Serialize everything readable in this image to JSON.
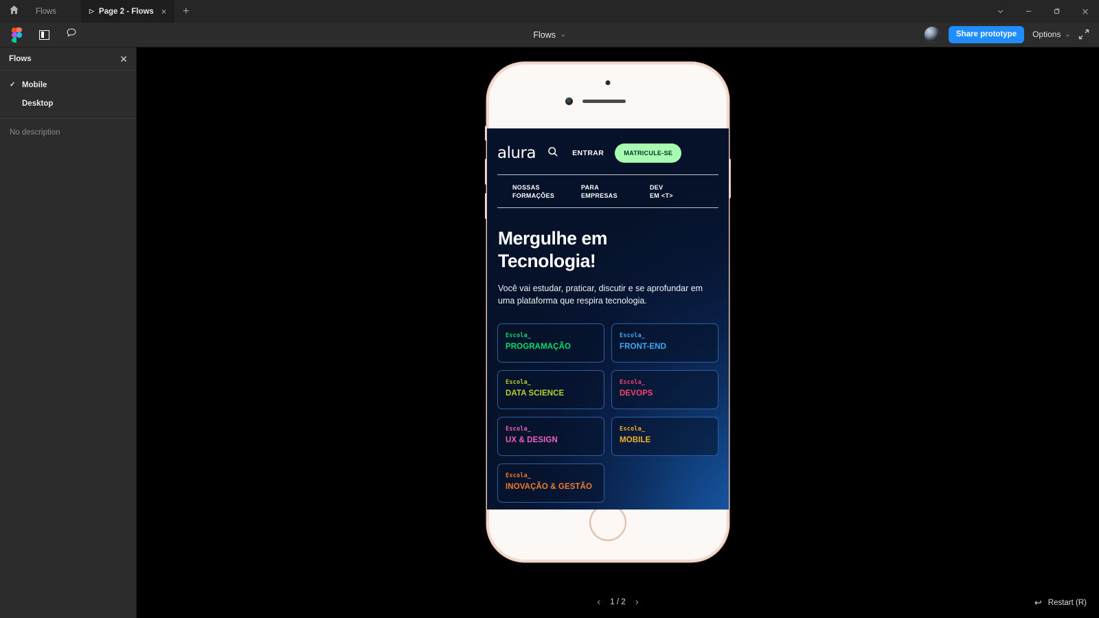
{
  "titlebar": {
    "home_icon": "home-icon",
    "tabs": [
      {
        "label": "Flows",
        "active": false,
        "icon": ""
      },
      {
        "label": "Page 2 - Flows",
        "active": true,
        "icon": "play-icon"
      }
    ],
    "new_tab": "+",
    "window_controls": [
      "chevron-down-icon",
      "minimize-icon",
      "maximize-icon",
      "close-icon"
    ],
    "tab_close": "×"
  },
  "toolbar": {
    "figma_logo": "figma-logo",
    "panel_toggle_icon": "layout-panel-icon",
    "comment_icon": "comment-bubble-icon",
    "title": "Flows",
    "title_chevron": "⌄",
    "avatar": "user-avatar",
    "share_label": "Share prototype",
    "options_label": "Options",
    "options_chevron": "⌄",
    "fullscreen_icon": "fullscreen-icon",
    "accent_blue": "#1f8cff"
  },
  "sidebar": {
    "title": "Flows",
    "close": "✕",
    "items": [
      {
        "label": "Mobile",
        "checked": true,
        "check": "✓"
      },
      {
        "label": "Desktop",
        "checked": false,
        "check": ""
      }
    ],
    "description": "No description"
  },
  "prototype": {
    "device": "iphone-8-white",
    "site": {
      "logo": "alura",
      "search_icon": "search-icon",
      "login_label": "ENTRAR",
      "cta_label": "MATRICULE-SE",
      "cta_color": "#a6ffb0",
      "nav": [
        {
          "line1": "NOSSAS",
          "line2": "FORMAÇÕES"
        },
        {
          "line1": "PARA",
          "line2": "EMPRESAS"
        },
        {
          "line1": "DEV",
          "line2": "EM <T>"
        }
      ],
      "hero_title_line1": "Mergulhe em",
      "hero_title_line2": "Tecnologia!",
      "hero_sub": "Você vai estudar, praticar, discutir e se aprofundar em uma plataforma que respira tecnologia.",
      "card_kicker": "Escola_",
      "cards": [
        {
          "kicker": "Escola_",
          "name": "PROGRAMAÇÃO",
          "color": "#00e06a"
        },
        {
          "kicker": "Escola_",
          "name": "FRONT-END",
          "color": "#3fa9f5"
        },
        {
          "kicker": "Escola_",
          "name": "DATA SCIENCE",
          "color": "#b4d12c"
        },
        {
          "kicker": "Escola_",
          "name": "DEVOPS",
          "color": "#f4436c"
        },
        {
          "kicker": "Escola_",
          "name": "UX & DESIGN",
          "color": "#f062c0"
        },
        {
          "kicker": "Escola_",
          "name": "MOBILE",
          "color": "#f5b423"
        },
        {
          "kicker": "Escola_",
          "name": "INOVAÇÃO & GESTÃO",
          "color": "#f07c2b"
        }
      ]
    }
  },
  "footer": {
    "prev_arrow": "‹",
    "counter": "1 / 2",
    "next_arrow": "›",
    "restart_icon": "↩",
    "restart_label": "Restart (R)"
  }
}
